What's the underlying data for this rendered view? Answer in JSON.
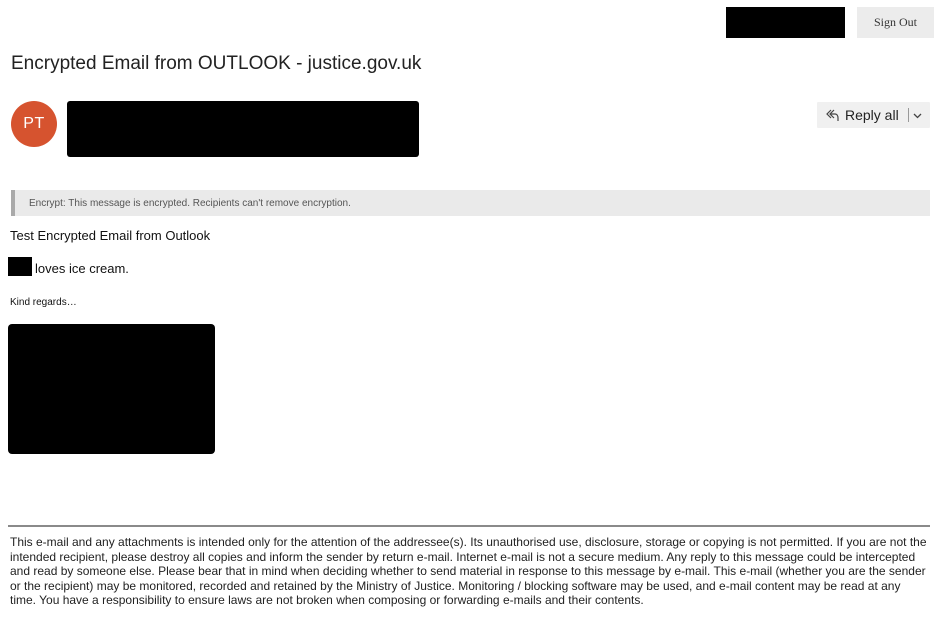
{
  "header": {
    "sign_out_label": "Sign Out"
  },
  "message": {
    "subject": "Encrypted Email from OUTLOOK - justice.gov.uk",
    "sender_initials": "PT",
    "avatar_color": "#d6532f",
    "reply_all_label": "Reply all",
    "encryption_notice": "Encrypt: This message is encrypted. Recipients can't remove encryption.",
    "body_line1": "Test Encrypted Email from Outlook",
    "body_line2": "loves ice cream.",
    "signoff": "Kind regards…",
    "disclaimer": "This e-mail and any attachments is intended only for the attention of the addressee(s). Its unauthorised use, disclosure, storage or copying is not permitted. If you are not the intended recipient, please destroy all copies and inform the sender by return e-mail. Internet e-mail is not a secure medium. Any reply to this message could be intercepted and read by someone else. Please bear that in mind when deciding whether to send material in response to this message by e-mail. This e-mail (whether you are the sender or the recipient) may be monitored, recorded and retained by the Ministry of Justice. Monitoring / blocking software may be used, and e-mail content may be read at any time. You have a responsibility to ensure laws are not broken when composing or forwarding e-mails and their contents."
  },
  "icons": {
    "reply_all": "reply-all-icon",
    "dropdown": "chevron-down-icon"
  }
}
